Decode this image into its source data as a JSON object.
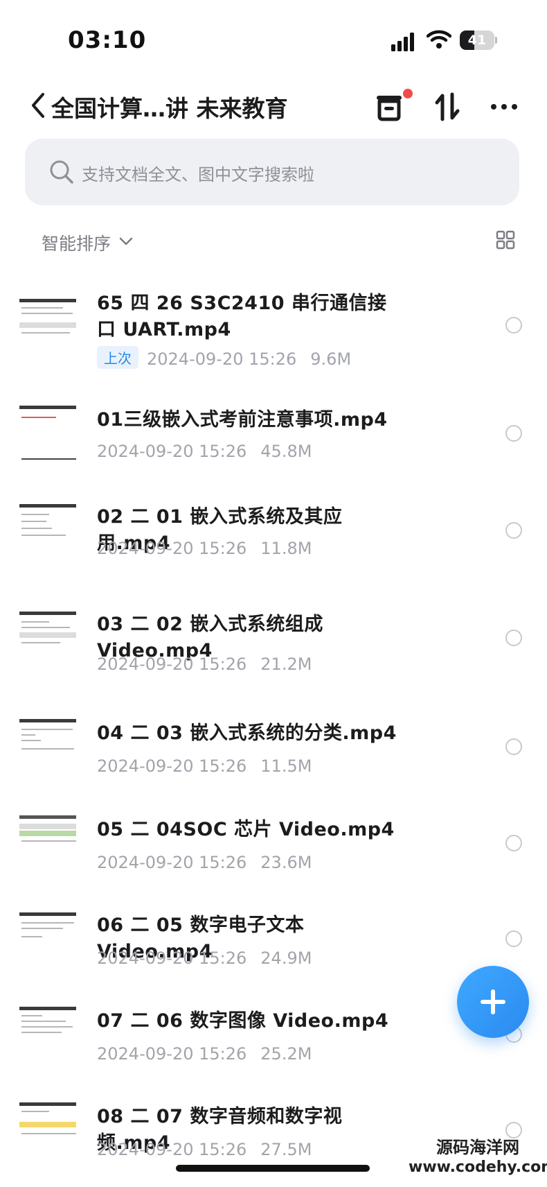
{
  "status_bar": {
    "time": "03:10",
    "battery": "41",
    "battery_level": 0.41
  },
  "nav": {
    "title": "全国计算…讲 未来教育"
  },
  "search": {
    "placeholder": "支持文档全文、图中文字搜索啦"
  },
  "sort": {
    "label": "智能排序"
  },
  "files": [
    {
      "name": "65 四 26 S3C2410 串行通信接口 UART.mp4",
      "tag": "上次",
      "date": "2024-09-20 15:26",
      "size": "9.6M"
    },
    {
      "name": "01三级嵌入式考前注意事项.mp4",
      "tag": "",
      "date": "2024-09-20 15:26",
      "size": "45.8M"
    },
    {
      "name": "02 二 01 嵌入式系统及其应用.mp4",
      "tag": "",
      "date": "2024-09-20 15:26",
      "size": "11.8M"
    },
    {
      "name": "03 二 02 嵌入式系统组成 Video.mp4",
      "tag": "",
      "date": "2024-09-20 15:26",
      "size": "21.2M"
    },
    {
      "name": "04 二 03 嵌入式系统的分类.mp4",
      "tag": "",
      "date": "2024-09-20 15:26",
      "size": "11.5M"
    },
    {
      "name": "05 二 04SOC 芯片 Video.mp4",
      "tag": "",
      "date": "2024-09-20 15:26",
      "size": "23.6M"
    },
    {
      "name": "06 二 05 数字电子文本 Video.mp4",
      "tag": "",
      "date": "2024-09-20 15:26",
      "size": "24.9M"
    },
    {
      "name": "07 二 06 数字图像 Video.mp4",
      "tag": "",
      "date": "2024-09-20 15:26",
      "size": "25.2M"
    },
    {
      "name": "08 二 07 数字音频和数字视频.mp4",
      "tag": "",
      "date": "2024-09-20 15:26",
      "size": "27.5M"
    }
  ],
  "watermark": {
    "title": "源码海洋网",
    "url": "www.codehy.com"
  },
  "colors": {
    "accent": "#2b88e4",
    "badge_dot": "#f04a4a",
    "search_bg": "#eef0f4",
    "meta_text": "#a2a4ab"
  }
}
